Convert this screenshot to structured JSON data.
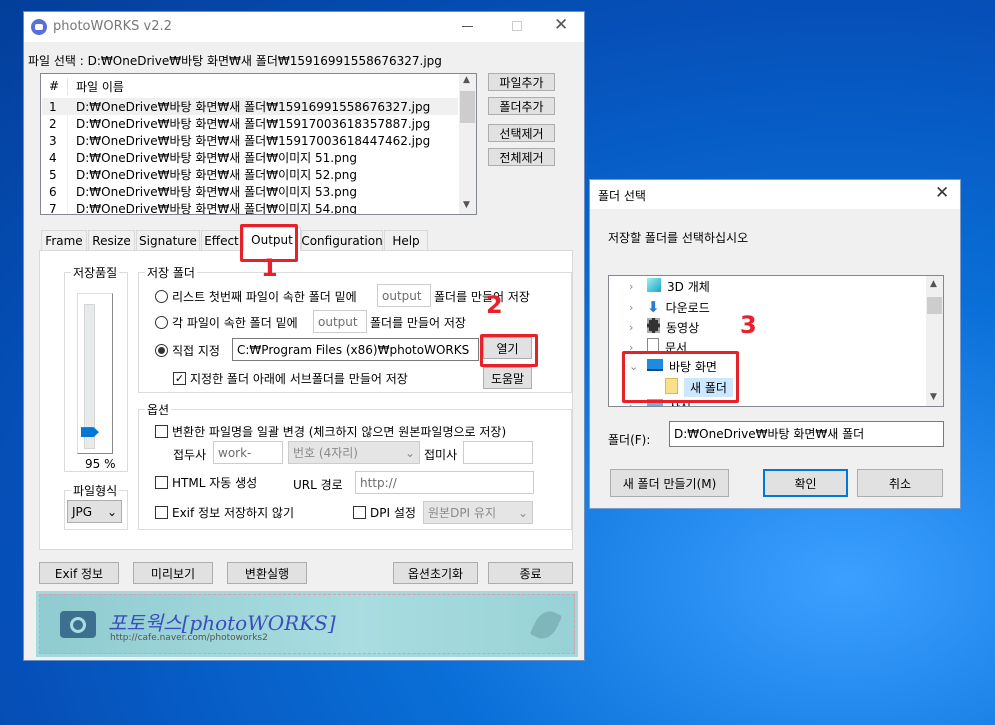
{
  "app": {
    "title": "photoWORKS v2.2",
    "file_select_label": "파일 선택 : D:₩OneDrive₩바탕 화면₩새 폴더₩15916991558676327.jpg"
  },
  "file_list": {
    "headers": [
      "#",
      "파일 이름"
    ],
    "rows": [
      {
        "n": "1",
        "f": "D:₩OneDrive₩바탕 화면₩새 폴더₩15916991558676327.jpg"
      },
      {
        "n": "2",
        "f": "D:₩OneDrive₩바탕 화면₩새 폴더₩15917003618357887.jpg"
      },
      {
        "n": "3",
        "f": "D:₩OneDrive₩바탕 화면₩새 폴더₩15917003618447462.jpg"
      },
      {
        "n": "4",
        "f": "D:₩OneDrive₩바탕 화면₩새 폴더₩이미지 51.png"
      },
      {
        "n": "5",
        "f": "D:₩OneDrive₩바탕 화면₩새 폴더₩이미지 52.png"
      },
      {
        "n": "6",
        "f": "D:₩OneDrive₩바탕 화면₩새 폴더₩이미지 53.png"
      },
      {
        "n": "7",
        "f": "D:₩OneDrive₩바탕 화면₩새 폴더₩이미지 54.png"
      }
    ]
  },
  "side_buttons": {
    "add_file": "파일추가",
    "add_folder": "폴더추가",
    "remove_selected": "선택제거",
    "remove_all": "전체제거"
  },
  "tabs": [
    {
      "label": "Frame"
    },
    {
      "label": "Resize"
    },
    {
      "label": "Signature"
    },
    {
      "label": "Effect"
    },
    {
      "label": "Output",
      "active": true
    },
    {
      "label": "Configuration"
    },
    {
      "label": "Help"
    }
  ],
  "quality": {
    "label": "저장품질",
    "value_text": "95 %",
    "value": 95
  },
  "format": {
    "label": "파일형식",
    "selected": "JPG"
  },
  "save_folder": {
    "label": "저장 폴더",
    "opt1_a": "리스트 첫번째 파일이 속한 폴더 밑에",
    "opt1_input": "output",
    "opt1_b": "폴더를 만들어 저장",
    "opt2_a": "각 파일이 속한 폴더 밑에",
    "opt2_input": "output",
    "opt2_b": "폴더를 만들어 저장",
    "opt3": "직접 지정",
    "path": "C:₩Program Files (x86)₩photoWORKS",
    "open_button": "열기",
    "help_button": "도움말",
    "subfolder_check": "지정한 폴더 아래에 서브폴더를 만들어 저장",
    "selected_option": 3,
    "subfolder_checked": true
  },
  "options": {
    "label": "옵션",
    "rename_check": "변환한 파일명을 일괄 변경 (체크하지 않으면 원본파일명으로 저장)",
    "prefix_label": "접두사",
    "prefix_value": "work-",
    "number_select": "번호 (4자리)",
    "suffix_label": "접미사",
    "suffix_value": "",
    "html_check": "HTML 자동 생성",
    "url_label": "URL 경로",
    "url_value": "http://",
    "exif_check": "Exif 정보 저장하지 않기",
    "dpi_check": "DPI 설정",
    "dpi_select": "원본DPI 유지"
  },
  "bottom_buttons": {
    "exif": "Exif 정보",
    "preview": "미리보기",
    "convert": "변환실행",
    "reset": "옵션초기화",
    "exit": "종료"
  },
  "banner": {
    "title": "포토웍스[photoWORKS]",
    "url": "http://cafe.naver.com/photoworks2"
  },
  "annotations": [
    "1",
    "2",
    "3"
  ],
  "dialog": {
    "title": "폴더 선택",
    "instruction": "저장할 폴더를 선택하십시오",
    "tree": [
      {
        "label": "3D 개체",
        "icon": "cube-icon"
      },
      {
        "label": "다운로드",
        "icon": "download-arrow-icon"
      },
      {
        "label": "동영상",
        "icon": "film-icon"
      },
      {
        "label": "문서",
        "icon": "document-icon"
      },
      {
        "label": "바탕 화면",
        "icon": "desktop-icon",
        "expanded": true
      },
      {
        "label": "새 폴더",
        "icon": "folder-icon",
        "selected": true
      },
      {
        "label": "사진",
        "icon": "pictures-icon"
      }
    ],
    "folder_label": "폴더(F):",
    "folder_value": "D:₩OneDrive₩바탕 화면₩새 폴더",
    "new_folder": "새 폴더 만들기(M)",
    "ok": "확인",
    "cancel": "취소"
  },
  "colors": {
    "annotation_red": "#e8202a",
    "accent_blue": "#0078d7"
  }
}
